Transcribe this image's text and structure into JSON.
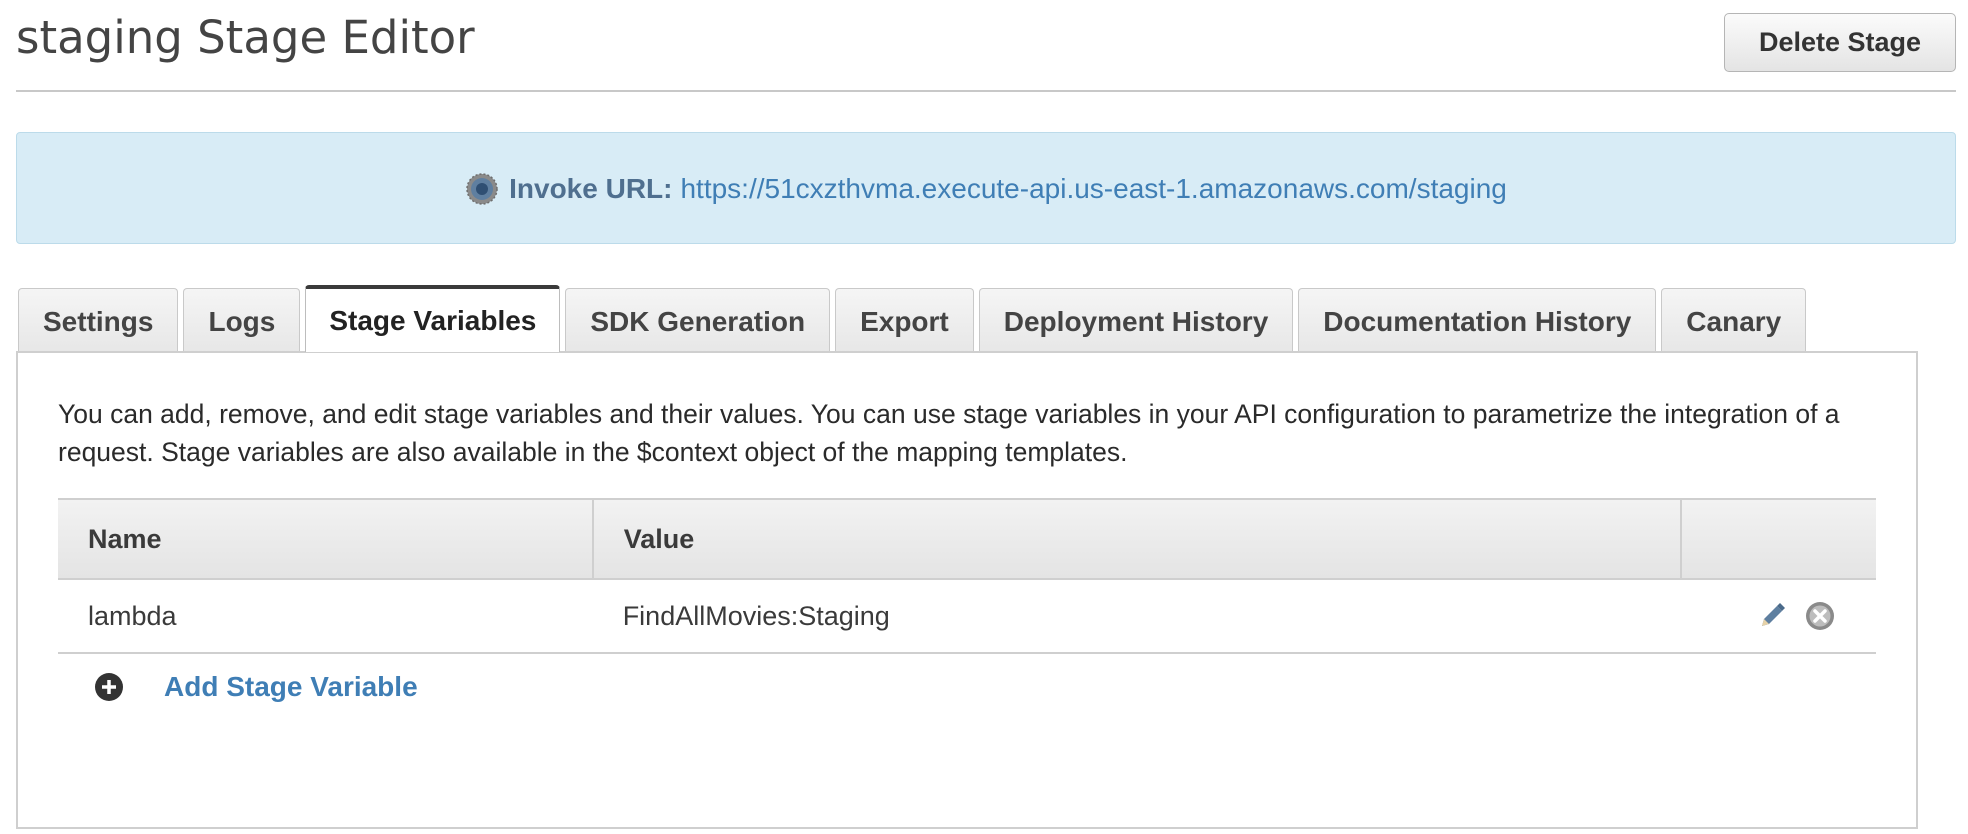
{
  "header": {
    "title": "staging Stage Editor",
    "delete_button": "Delete Stage"
  },
  "banner": {
    "icon": "globe-icon",
    "label": "Invoke URL:",
    "url": "https://51cxzthvma.execute-api.us-east-1.amazonaws.com/staging"
  },
  "tabs": [
    {
      "label": "Settings",
      "active": false
    },
    {
      "label": "Logs",
      "active": false
    },
    {
      "label": "Stage Variables",
      "active": true
    },
    {
      "label": "SDK Generation",
      "active": false
    },
    {
      "label": "Export",
      "active": false
    },
    {
      "label": "Deployment History",
      "active": false
    },
    {
      "label": "Documentation History",
      "active": false
    },
    {
      "label": "Canary",
      "active": false
    }
  ],
  "panel": {
    "description": "You can add, remove, and edit stage variables and their values. You can use stage variables in your API configuration to parametrize the integration of a request. Stage variables are also available in the $context object of the mapping templates.",
    "table": {
      "columns": [
        "Name",
        "Value",
        ""
      ],
      "rows": [
        {
          "name": "lambda",
          "value": "FindAllMovies:Staging",
          "actions": [
            "pencil-icon",
            "remove-icon"
          ]
        }
      ]
    },
    "add_label": "Add Stage Variable",
    "add_icon": "plus-circle-icon"
  },
  "colors": {
    "link": "#3f7eb5",
    "banner_bg": "#d8ecf6",
    "icon_gray": "#5a5a5a"
  }
}
